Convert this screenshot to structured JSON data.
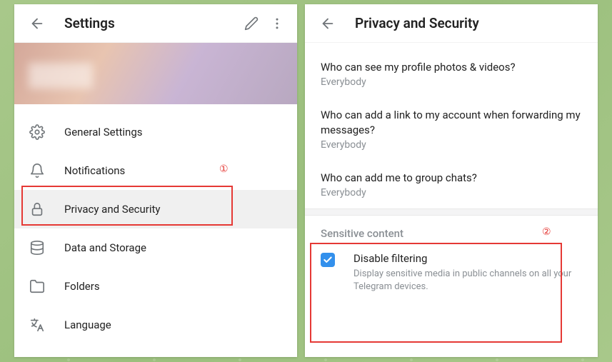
{
  "left": {
    "title": "Settings",
    "menu": [
      {
        "label": "General Settings"
      },
      {
        "label": "Notifications"
      },
      {
        "label": "Privacy and Security"
      },
      {
        "label": "Data and Storage"
      },
      {
        "label": "Folders"
      },
      {
        "label": "Language"
      }
    ]
  },
  "right": {
    "title": "Privacy and Security",
    "items": [
      {
        "title": "Who can see my profile photos & videos?",
        "value": "Everybody"
      },
      {
        "title": "Who can add a link to my account when forwarding my messages?",
        "value": "Everybody"
      },
      {
        "title": "Who can add me to group chats?",
        "value": "Everybody"
      }
    ],
    "section": {
      "header": "Sensitive content",
      "check_label": "Disable filtering",
      "check_desc": "Display sensitive media in public channels on all your Telegram devices."
    }
  },
  "annotations": {
    "one": "①",
    "two": "②"
  }
}
